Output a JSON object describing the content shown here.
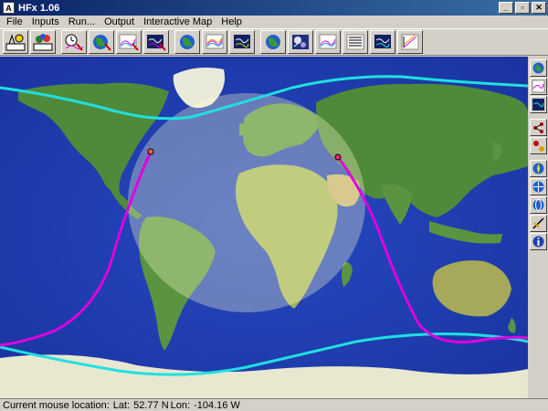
{
  "window": {
    "title": "HFx 1.06",
    "minimize": "_",
    "restore": "▫",
    "close": "✕"
  },
  "menu": [
    "File",
    "Inputs",
    "Run...",
    "Output",
    "Interactive Map",
    "Help"
  ],
  "toolbar": {
    "groups": [
      [
        "antenna-site-icon",
        "antenna-pattern-icon"
      ],
      [
        "clock-chart-icon",
        "globe-run-icon",
        "graph-run-icon",
        "map-run-icon"
      ],
      [
        "globe-output-icon",
        "graph-output-icon",
        "map-output-icon"
      ],
      [
        "globe-view-icon",
        "satellite-image-icon",
        "graph-view-icon",
        "table-view-icon",
        "map-view-icon",
        "ruler-chart-icon"
      ]
    ]
  },
  "sidebar": [
    "globe-icon",
    "chart-icon",
    "monitor-icon",
    "network-icon",
    "transmitter-receiver-icon",
    "compass-icon",
    "globe-2-icon",
    "globe-3-icon",
    "path-tool-icon",
    "info-icon"
  ],
  "status": {
    "label": "Current mouse location:",
    "lat_label": "Lat:",
    "lat": "52.77 N",
    "lon_label": "Lon:",
    "lon": "-104.16 W"
  },
  "colors": {
    "ocean": "#1f3fb0",
    "land": "#4f8a3a",
    "ice": "#f0f0d8",
    "daylight": "#ffffcc",
    "path": "#e000e0",
    "terminator": "#20e0e0",
    "titlebar": "#0a246a"
  }
}
